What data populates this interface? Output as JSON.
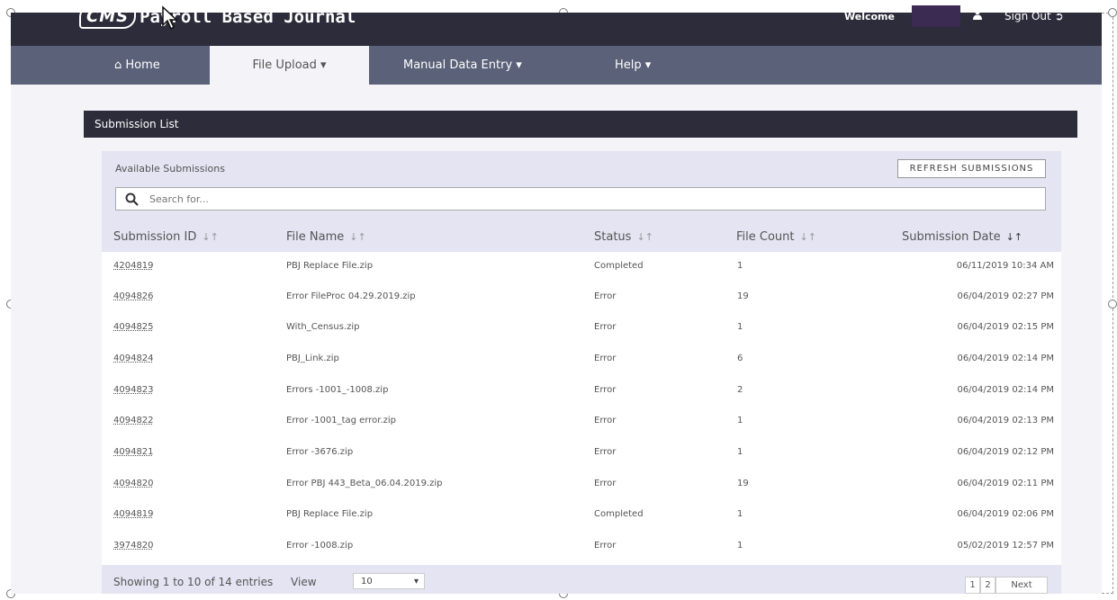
{
  "header": {
    "logo": "CMS",
    "title": "Payroll Based Journal",
    "welcome": "Welcome",
    "signout": "Sign Out"
  },
  "nav": {
    "home": "Home",
    "file_upload": "File Upload",
    "manual_entry": "Manual Data Entry",
    "help": "Help"
  },
  "panel": {
    "title": "Submission List",
    "available": "Available Submissions",
    "refresh": "REFRESH SUBMISSIONS",
    "search_placeholder": "Search for..."
  },
  "table": {
    "headers": [
      "Submission ID",
      "File Name",
      "Status",
      "File Count",
      "Submission Date"
    ],
    "rows": [
      [
        "4204819",
        "PBJ Replace File.zip",
        "Completed",
        "1",
        "06/11/2019 10:34 AM"
      ],
      [
        "4094826",
        "Error FileProc 04.29.2019.zip",
        "Error",
        "19",
        "06/04/2019 02:27 PM"
      ],
      [
        "4094825",
        "With_Census.zip",
        "Error",
        "1",
        "06/04/2019 02:15 PM"
      ],
      [
        "4094824",
        "PBJ_Link.zip",
        "Error",
        "6",
        "06/04/2019 02:14 PM"
      ],
      [
        "4094823",
        "Errors -1001_-1008.zip",
        "Error",
        "2",
        "06/04/2019 02:14 PM"
      ],
      [
        "4094822",
        "Error -1001_tag error.zip",
        "Error",
        "1",
        "06/04/2019 02:13 PM"
      ],
      [
        "4094821",
        "Error -3676.zip",
        "Error",
        "1",
        "06/04/2019 02:12 PM"
      ],
      [
        "4094820",
        "Error PBJ 443_Beta_06.04.2019.zip",
        "Error",
        "19",
        "06/04/2019 02:11 PM"
      ],
      [
        "4094819",
        "PBJ Replace File.zip",
        "Completed",
        "1",
        "06/04/2019 02:06 PM"
      ],
      [
        "3974820",
        "Error -1008.zip",
        "Error",
        "1",
        "05/02/2019 12:57 PM"
      ]
    ]
  },
  "footer": {
    "showing": "Showing 1 to 10 of 14 entries",
    "view_label": "View",
    "view_value": "10",
    "pages": [
      "1",
      "2"
    ],
    "next": "Next"
  },
  "colors": {
    "topbar": "#2c2c3a",
    "nav": "#5a6178",
    "panel": "#e4e4f2"
  }
}
